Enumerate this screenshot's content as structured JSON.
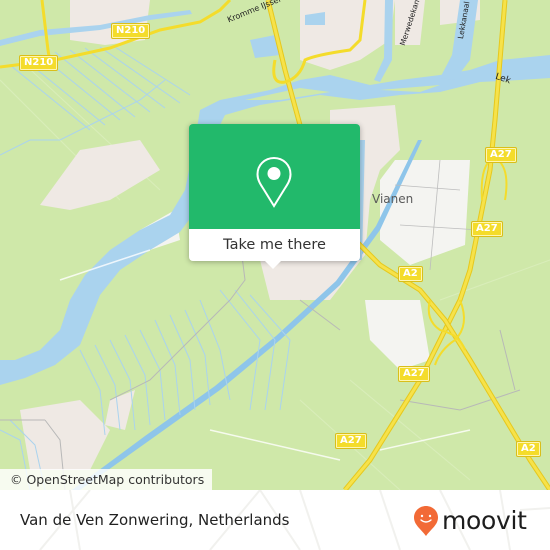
{
  "map": {
    "labels": {
      "place_vianen": "Vianen",
      "street_kromme_ijssel": "Kromme IJssel",
      "water_merwedekanaal": "Merwedekanaal",
      "water_lekkanaal": "Lekkanaal",
      "water_lek": "Lek"
    },
    "road_shields": [
      {
        "label": "N210",
        "road": "N210"
      },
      {
        "label": "N210",
        "road": "N210"
      },
      {
        "label": "A27",
        "road": "A27"
      },
      {
        "label": "A27",
        "road": "A27"
      },
      {
        "label": "A2",
        "road": "A2"
      },
      {
        "label": "A27",
        "road": "A27"
      },
      {
        "label": "A27",
        "road": "A27"
      },
      {
        "label": "A2",
        "road": "A2"
      }
    ],
    "colors": {
      "land": "#cfe8a9",
      "water": "#aad3ee",
      "urban": "#efe9e4",
      "motorway": "#f4dc2b"
    }
  },
  "popup": {
    "icon": "location-pin-icon",
    "button_label": "Take me there",
    "color": "#22b96b"
  },
  "attribution": {
    "text": "© OpenStreetMap contributors"
  },
  "footer": {
    "title": "Van de Ven Zonwering, Netherlands",
    "brand": "moovit",
    "brand_color": "#f26a36"
  }
}
